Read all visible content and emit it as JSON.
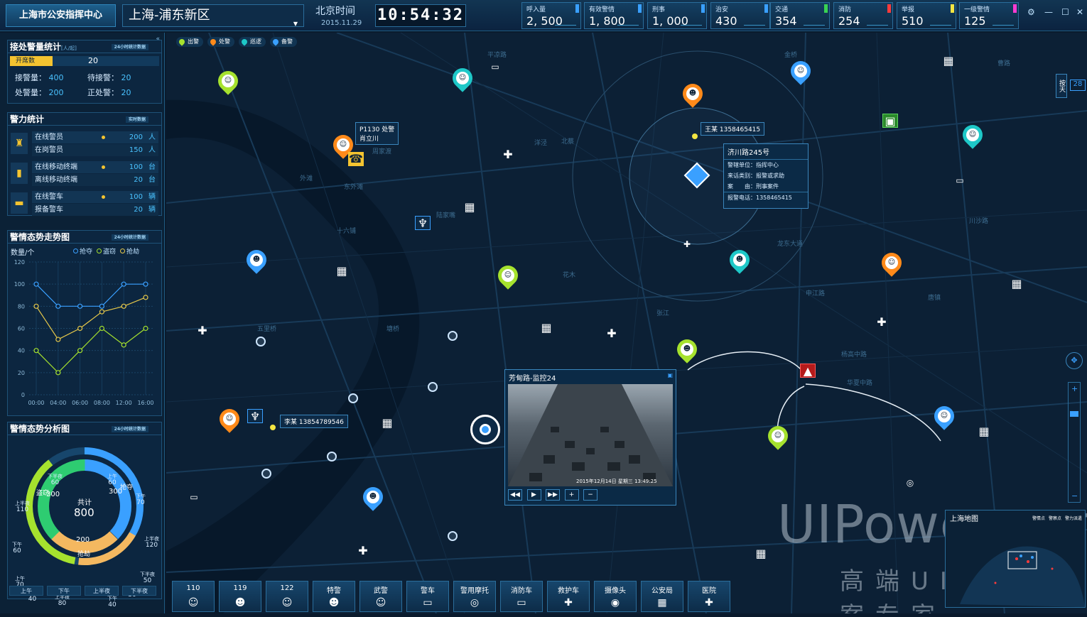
{
  "header": {
    "app_name": "上海市公安指挥中心",
    "district": "上海-浦东新区",
    "time_label": "北京时间",
    "date": "2015.11.29",
    "clock": "10:54:32",
    "stats": [
      {
        "label": "呼入量",
        "value": "2, 500",
        "color": "#3aa0ff"
      },
      {
        "label": "有效警情",
        "value": "1, 800",
        "color": "#3aa0ff"
      },
      {
        "label": "刑事",
        "value": "1, 000",
        "color": "#3aa0ff"
      },
      {
        "label": "治安",
        "value": "430",
        "color": "#3aa0ff"
      },
      {
        "label": "交通",
        "value": "354",
        "color": "#39d353"
      },
      {
        "label": "消防",
        "value": "254",
        "color": "#ff3b3b"
      },
      {
        "label": "举报",
        "value": "510",
        "color": "#f4e542"
      },
      {
        "label": "一级警情",
        "value": "125",
        "color": "#ff3bd1"
      }
    ]
  },
  "left": {
    "alarm_stats": {
      "title": "接处警量统计",
      "unit": "[人/起]",
      "tag": "24小时统计数据",
      "open_label": "开席数",
      "open_value": "20",
      "received_label": "接警量：",
      "received": "400",
      "waiting_label": "待接警：",
      "waiting": "20",
      "handled_label": "处警量：",
      "handled": "200",
      "handling_label": "正处警：",
      "handling": "20"
    },
    "force": {
      "title": "警力统计",
      "tag": "实时数据",
      "rows": [
        {
          "icon": "police-badge-icon",
          "glyph": "♜",
          "a_label": "在线警员",
          "a_val": "200",
          "a_unit": "人",
          "b_label": "在岗警员",
          "b_val": "150",
          "b_unit": "人"
        },
        {
          "icon": "radio-icon",
          "glyph": "▮",
          "a_label": "在线移动终端",
          "a_val": "100",
          "a_unit": "台",
          "b_label": "离线移动终端",
          "b_val": "20",
          "b_unit": "台"
        },
        {
          "icon": "police-car-icon",
          "glyph": "▬",
          "a_label": "在线警车",
          "a_val": "100",
          "a_unit": "辆",
          "b_label": "报备警车",
          "b_val": "20",
          "b_unit": "辆"
        }
      ]
    },
    "trend": {
      "title": "警情态势走势图",
      "tag": "24小时统计数据",
      "ylabel": "数量/个",
      "legend": [
        "抢夺",
        "盗窃",
        "抢劫"
      ]
    },
    "analysis": {
      "title": "警情态势分析图",
      "tag": "24小时统计数据",
      "total_label": "共计",
      "total": "800",
      "inner_labels": {
        "theft": "盗窃",
        "theft_v": "300",
        "robbery": "抢夺",
        "robbery_v": "300",
        "snatch": "抢劫",
        "snatch_v": "200"
      },
      "outer": [
        {
          "period": "下半夜",
          "v": "60"
        },
        {
          "period": "上午",
          "v": "60"
        },
        {
          "period": "下午",
          "v": "70"
        },
        {
          "period": "上半夜",
          "v": "110"
        },
        {
          "period": "上半夜",
          "v": "120"
        },
        {
          "period": "下午",
          "v": "60"
        },
        {
          "period": "上午",
          "v": "70"
        },
        {
          "period": "下半夜",
          "v": "50"
        },
        {
          "period": "下半夜",
          "v": "40"
        },
        {
          "period": "上半夜",
          "v": "80"
        },
        {
          "period": "下午",
          "v": "40"
        },
        {
          "period": "上午",
          "v": "30"
        }
      ],
      "tabs": [
        "上午",
        "下午",
        "上半夜",
        "下半夜"
      ]
    }
  },
  "chart_data": {
    "type": "line",
    "x": [
      "00:00",
      "04:00",
      "06:00",
      "08:00",
      "12:00",
      "16:00"
    ],
    "ylim": [
      0,
      120
    ],
    "yticks": [
      0,
      20,
      40,
      60,
      80,
      100,
      120
    ],
    "series": [
      {
        "name": "抢夺",
        "color": "#3aa0ff",
        "values": [
          100,
          80,
          80,
          80,
          100,
          100
        ]
      },
      {
        "name": "盗窃",
        "color": "#a6e22e",
        "values": [
          40,
          20,
          40,
          60,
          45,
          60
        ]
      },
      {
        "name": "抢劫",
        "color": "#e6c84a",
        "values": [
          80,
          50,
          60,
          75,
          80,
          88
        ]
      }
    ]
  },
  "map": {
    "legend": [
      {
        "label": "出警",
        "color": "#a6e22e"
      },
      {
        "label": "处警",
        "color": "#ff8a1a"
      },
      {
        "label": "巡逻",
        "color": "#1ec8c8"
      },
      {
        "label": "备警",
        "color": "#3aa0ff"
      }
    ],
    "car_label_id": "P1130",
    "car_label_name": "肖立川",
    "car_label_status": "处警",
    "person1_label": "王某  1358465415",
    "person2_label": "李某  13854789546",
    "info": {
      "title": "济川路245号",
      "unit_label": "警辖单位：",
      "unit": "指挥中心",
      "type_label": "来话类别：",
      "type": "报警或求助",
      "reason_label": "案　　由：",
      "reason": "刑事案件",
      "phone_label": "报警电话：",
      "phone": "1358465415"
    },
    "video": {
      "title": "芳甸路-监控24",
      "timestamp": "2015年12月14日  星期三  13:49:25"
    },
    "minimap_title": "上海地图",
    "minimap_legend": [
      "警情点",
      "警察点",
      "警力派遣"
    ],
    "side_tab": "按天",
    "side_value": "28",
    "road_labels": [
      "平凉路",
      "东外滩",
      "十六铺",
      "外滩",
      "五里桥",
      "张江",
      "唐镇",
      "北蔡",
      "花木",
      "金桥",
      "曹路",
      "洋泾",
      "塘桥",
      "周家渡",
      "陆家嘴",
      "华夏中路",
      "龙东大道",
      "川沙路",
      "申江路",
      "杨高中路"
    ]
  },
  "bottom": [
    {
      "label": "110",
      "icon": "police-officer-icon",
      "glyph": "☺"
    },
    {
      "label": "119",
      "icon": "firefighter-icon",
      "glyph": "☻"
    },
    {
      "label": "122",
      "icon": "traffic-officer-icon",
      "glyph": "☺"
    },
    {
      "label": "特警",
      "icon": "swat-icon",
      "glyph": "☻"
    },
    {
      "label": "武警",
      "icon": "armed-police-icon",
      "glyph": "☺"
    },
    {
      "label": "警车",
      "icon": "police-car-icon",
      "glyph": "▭"
    },
    {
      "label": "警用摩托",
      "icon": "motorcycle-icon",
      "glyph": "◎"
    },
    {
      "label": "消防车",
      "icon": "fire-truck-icon",
      "glyph": "▭"
    },
    {
      "label": "救护车",
      "icon": "ambulance-icon",
      "glyph": "✚"
    },
    {
      "label": "摄像头",
      "icon": "camera-icon",
      "glyph": "◉"
    },
    {
      "label": "公安局",
      "icon": "police-station-icon",
      "glyph": "▦"
    },
    {
      "label": "医院",
      "icon": "hospital-icon",
      "glyph": "✚"
    }
  ],
  "watermark": {
    "main": "UIPower.com",
    "reg": "®",
    "sub": "高端UI解决方案专家"
  }
}
